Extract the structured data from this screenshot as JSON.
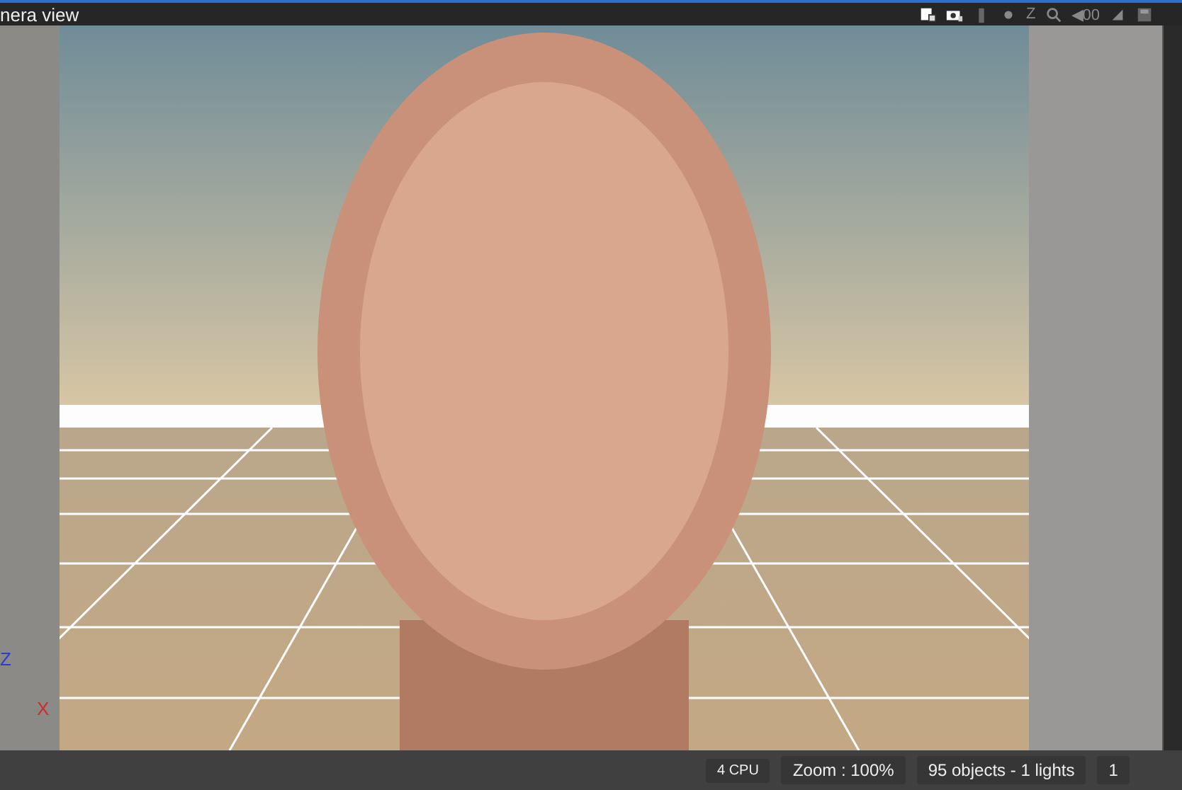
{
  "window": {
    "title": "nera view"
  },
  "toolbar": [
    {
      "kind": "render"
    },
    {
      "kind": "camera"
    },
    {
      "kind": "bar"
    },
    {
      "kind": "dot"
    },
    {
      "kind": "text",
      "label": "Z"
    },
    {
      "kind": "zoom"
    },
    {
      "kind": "text",
      "label": "◀00"
    },
    {
      "kind": "wedge"
    },
    {
      "kind": "disk"
    }
  ],
  "viewport": {
    "kind": "picture",
    "axes": [
      {
        "label": "Z",
        "color": "#2a3fd0"
      },
      {
        "label": "X",
        "color": "#d02a2a"
      }
    ]
  },
  "status_bar": [
    "4 CPU",
    "Zoom : 100%",
    "95 objects - 1 lights",
    "1"
  ]
}
